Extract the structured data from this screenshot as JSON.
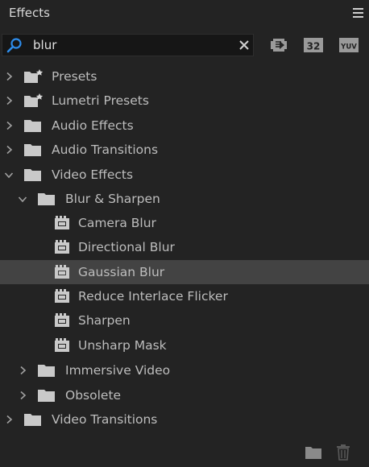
{
  "panel": {
    "title": "Effects"
  },
  "search": {
    "value": "blur"
  },
  "filters": [
    {
      "name": "accelerated-effects",
      "label": ""
    },
    {
      "name": "32-bit-color",
      "label": "32"
    },
    {
      "name": "yuv-effects",
      "label": "YUV"
    }
  ],
  "tree": [
    {
      "label": "Presets",
      "type": "preset-bin",
      "level": 0,
      "expanded": false
    },
    {
      "label": "Lumetri Presets",
      "type": "preset-bin",
      "level": 0,
      "expanded": false
    },
    {
      "label": "Audio Effects",
      "type": "folder",
      "level": 0,
      "expanded": false
    },
    {
      "label": "Audio Transitions",
      "type": "folder",
      "level": 0,
      "expanded": false
    },
    {
      "label": "Video Effects",
      "type": "folder",
      "level": 0,
      "expanded": true
    },
    {
      "label": "Blur & Sharpen",
      "type": "folder",
      "level": 1,
      "expanded": true
    },
    {
      "label": "Camera Blur",
      "type": "effect",
      "level": 2
    },
    {
      "label": "Directional Blur",
      "type": "effect",
      "level": 2
    },
    {
      "label": "Gaussian Blur",
      "type": "effect",
      "level": 2,
      "selected": true
    },
    {
      "label": "Reduce Interlace Flicker",
      "type": "effect",
      "level": 2
    },
    {
      "label": "Sharpen",
      "type": "effect",
      "level": 2
    },
    {
      "label": "Unsharp Mask",
      "type": "effect",
      "level": 2
    },
    {
      "label": "Immersive Video",
      "type": "folder",
      "level": 1,
      "expanded": false
    },
    {
      "label": "Obsolete",
      "type": "folder",
      "level": 1,
      "expanded": false
    },
    {
      "label": "Video Transitions",
      "type": "folder",
      "level": 0,
      "expanded": false
    }
  ],
  "icons": {
    "accent": "#2d8ceb",
    "folder": "#c9c9c9",
    "chevron": "#a0a0a0"
  }
}
